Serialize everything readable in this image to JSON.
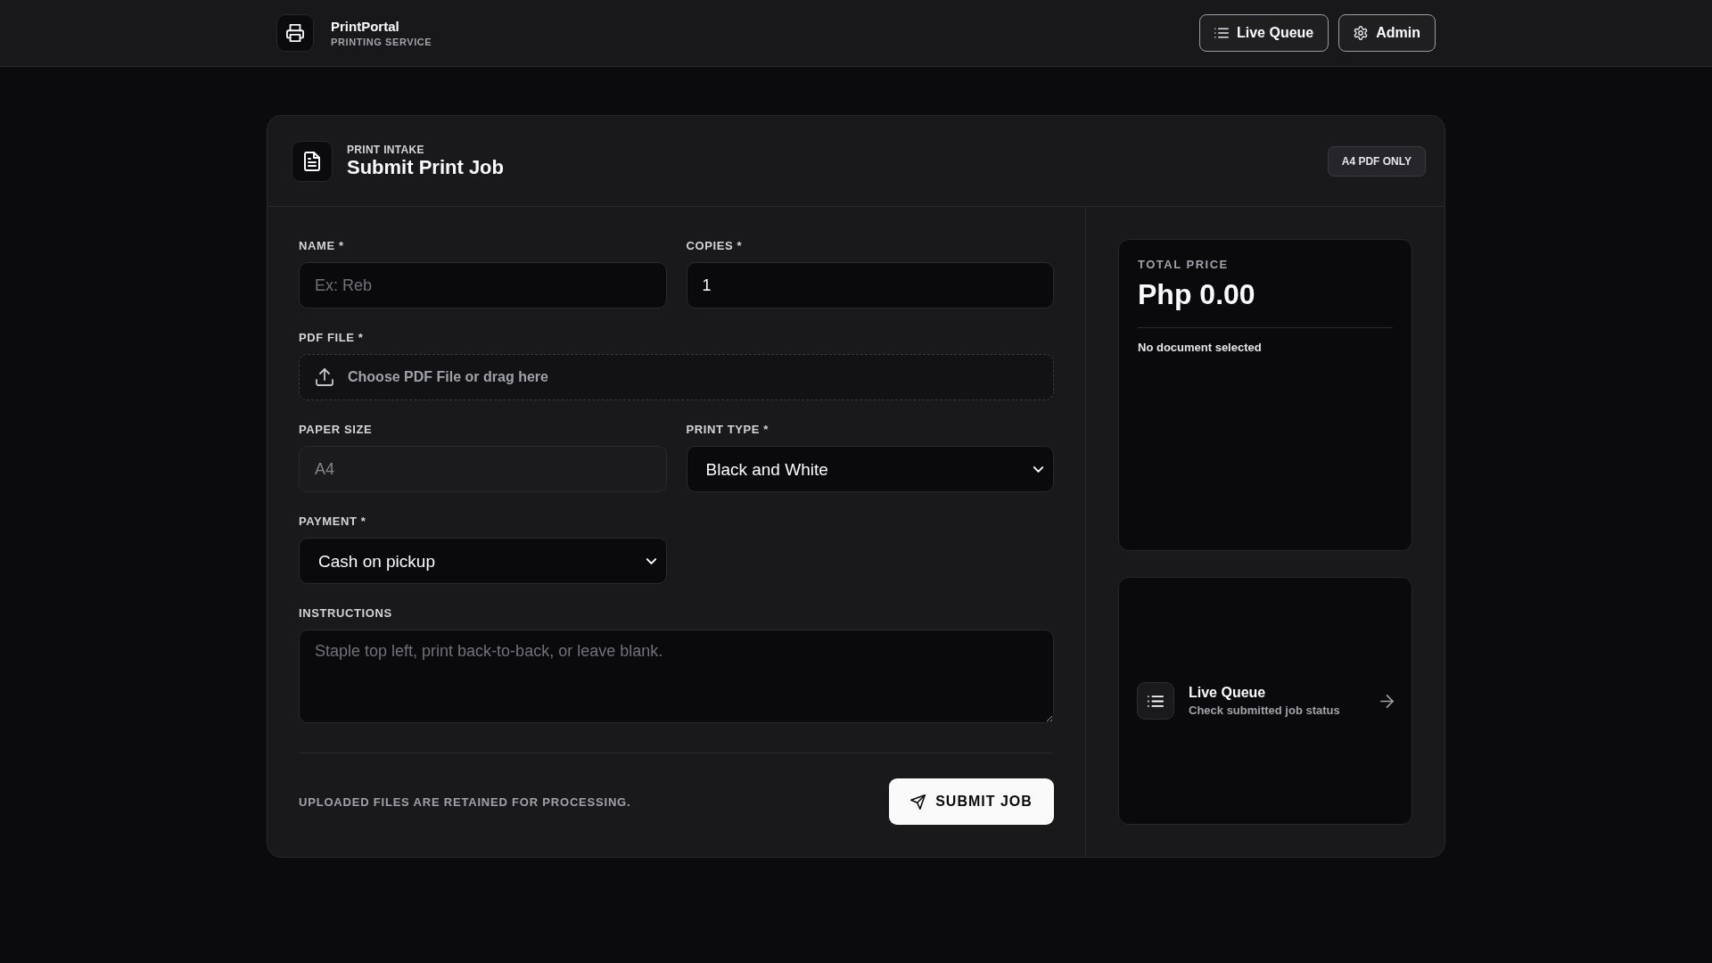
{
  "header": {
    "brand": {
      "title": "PrintPortal",
      "subtitle": "PRINTING SERVICE"
    },
    "buttons": [
      {
        "kind": "queue",
        "label": "Live Queue"
      },
      {
        "kind": "admin",
        "label": "Admin"
      }
    ]
  },
  "intake": {
    "eyebrow": "PRINT INTAKE",
    "title": "Submit Print Job",
    "badge": "A4 PDF ONLY",
    "fields": [
      {
        "kind": "text",
        "label": "NAME *",
        "placeholder": "Ex: Reb",
        "disabled": false
      },
      {
        "kind": "text",
        "label": "COPIES *",
        "value": "1",
        "disabled": false
      },
      {
        "kind": "file",
        "label": "PDF FILE *",
        "placeholder": "Choose PDF File or drag here",
        "disabled": false
      },
      {
        "kind": "text",
        "label": "PAPER SIZE",
        "value": "A4",
        "disabled": true
      },
      {
        "kind": "select",
        "label": "PRINT TYPE *",
        "value": "Black and White",
        "disabled": false
      },
      {
        "kind": "select",
        "label": "PAYMENT *",
        "value": "Cash on pickup",
        "disabled": false
      },
      {
        "kind": "textarea",
        "label": "INSTRUCTIONS",
        "placeholder": "Staple top left, print back-to-back, or leave blank.",
        "disabled": false
      }
    ],
    "note": "UPLOADED FILES ARE RETAINED FOR PROCESSING.",
    "submit": "SUBMIT JOB"
  },
  "summary": {
    "label": "TOTAL PRICE",
    "amount": "Php 0.00",
    "status": "No document selected"
  },
  "queue_link": {
    "title": "Live Queue",
    "subtitle": "Check submitted job status"
  }
}
